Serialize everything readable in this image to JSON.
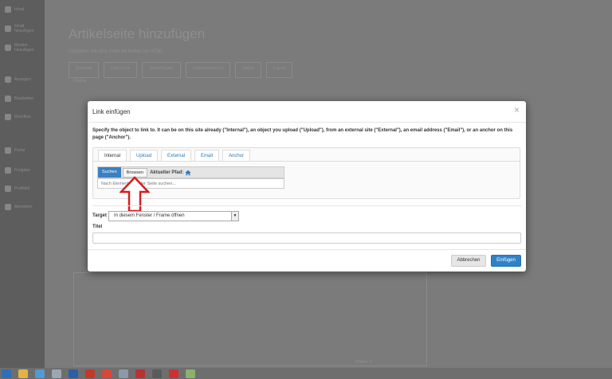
{
  "sidebar": {
    "items": [
      {
        "label": "Inhalt",
        "icon": "home-icon"
      },
      {
        "label": "Inhalt hinzufügen",
        "icon": "plus-icon"
      },
      {
        "label": "Medien hinzufügen",
        "icon": "plus-icon"
      },
      {
        "label": "Anzeigen",
        "icon": "eye-icon"
      },
      {
        "label": "Bearbeiten",
        "icon": "pencil-icon"
      },
      {
        "label": "Workflow",
        "icon": "pencil-icon"
      },
      {
        "label": "Portal",
        "icon": "portal-icon"
      },
      {
        "label": "Freigabe",
        "icon": "users-icon"
      },
      {
        "label": "Profilbild",
        "icon": "user-icon"
      },
      {
        "label": "Abmelden",
        "icon": "logout-icon"
      }
    ]
  },
  "page": {
    "title": "Artikelseite hinzufügen",
    "subtitle": "Gestalten Sie eine Seite für Artikel mit HTML",
    "tabs": [
      "Standard",
      "Kategorien",
      "Einstellungen",
      "Eigentümerschaft",
      "Datum",
      "Layout"
    ],
    "field_label": "Titel ▸",
    "editor_count": "Wörter: 0"
  },
  "dialog": {
    "title": "Link einfügen",
    "close": "×",
    "description": "Specify the object to link to. It can be on this site already (\"Internal\"), an object you upload (\"Upload\"), from an external site (\"External\"), an email address (\"Email\"), or an anchor on this page (\"Anchor\").",
    "tabs": [
      "Internal",
      "Upload",
      "External",
      "Email",
      "Anchor"
    ],
    "search_button": "Suchen",
    "browse_button": "Browsen",
    "current_path_label": "Aktueller Pfad:",
    "search_placeholder": "Nach Elementen in der Seite suchen...",
    "target_label": "Target",
    "target_value": "In diesem Fenster / Frame öffnen",
    "title_label": "Titel",
    "title_value": "",
    "cancel_button": "Abbrechen",
    "insert_button": "Einfügen"
  },
  "colors": {
    "primary": "#2e82c9",
    "annotation_arrow": "#d41f1f"
  },
  "taskbar": {
    "icons": [
      "outlook-icon",
      "folder-icon",
      "browser-icon",
      "app-icon",
      "word-icon",
      "app-icon",
      "chrome-icon",
      "app-icon",
      "app-icon",
      "app-icon",
      "pdf-icon",
      "app-icon"
    ]
  }
}
